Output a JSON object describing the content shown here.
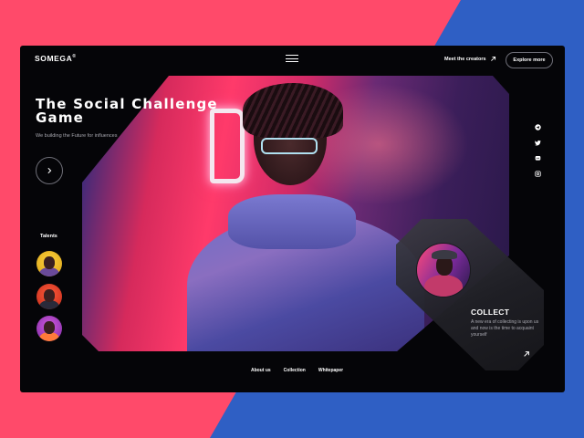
{
  "header": {
    "logo": "SOMEGA",
    "logo_mark": "®",
    "menu_icon": "hamburger-icon",
    "meet_link": "Meet the creators",
    "meet_icon": "arrow-up-right-icon",
    "explore_button": "Explore more"
  },
  "hero": {
    "title": "The Social Challenge Game",
    "subtitle": "We building the Future for influences",
    "next_icon": "chevron-right-icon"
  },
  "talents": {
    "label": "Talents",
    "avatars": [
      "talent-avatar-1",
      "talent-avatar-2",
      "talent-avatar-3"
    ]
  },
  "social": [
    "telegram-icon",
    "twitter-icon",
    "discord-icon",
    "instagram-icon"
  ],
  "collect": {
    "title": "COLLECT",
    "description": "A new era of collecting is upon us and now is the time to acquaint yourself",
    "arrow_icon": "arrow-up-right-icon"
  },
  "footer": {
    "links": [
      "About us",
      "Collection",
      "Whitepaper"
    ]
  },
  "colors": {
    "background_pink": "#ff4a6a",
    "background_blue": "#2f5fc4",
    "panel": "#050508"
  }
}
